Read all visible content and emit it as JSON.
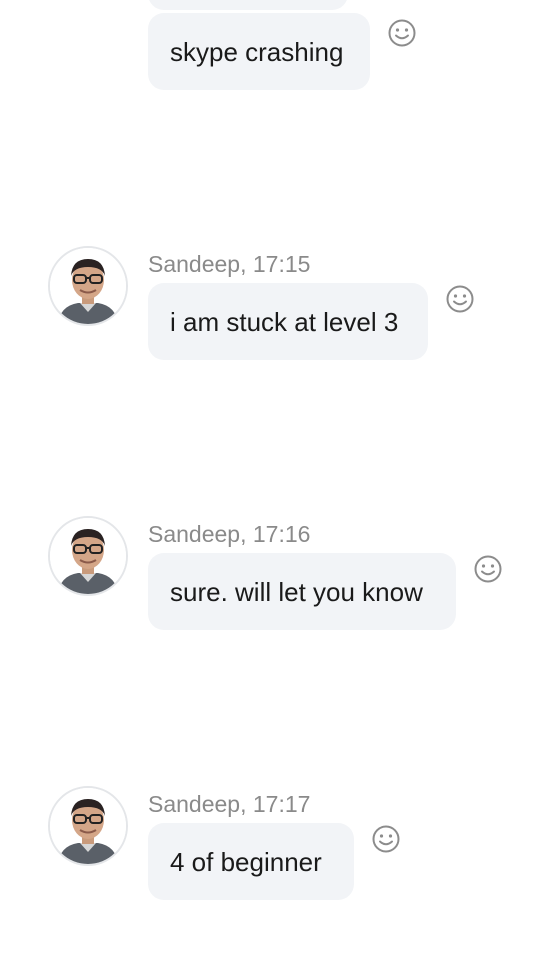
{
  "messages": [
    {
      "text": "skype crashing"
    },
    {
      "sender_line": "Sandeep, 17:15",
      "text": "i am stuck at level 3"
    },
    {
      "sender_line": "Sandeep, 17:16",
      "text": "sure. will let you know"
    },
    {
      "sender_line": "Sandeep, 17:17",
      "text": "4 of beginner"
    }
  ],
  "icons": {
    "reaction": "smiley-icon",
    "avatar": "avatar-photo"
  },
  "colors": {
    "bubble_bg": "#f2f4f7",
    "sender_text": "#8a8a8a",
    "message_text": "#1a1a1a",
    "icon_stroke": "#8c8c8c"
  }
}
